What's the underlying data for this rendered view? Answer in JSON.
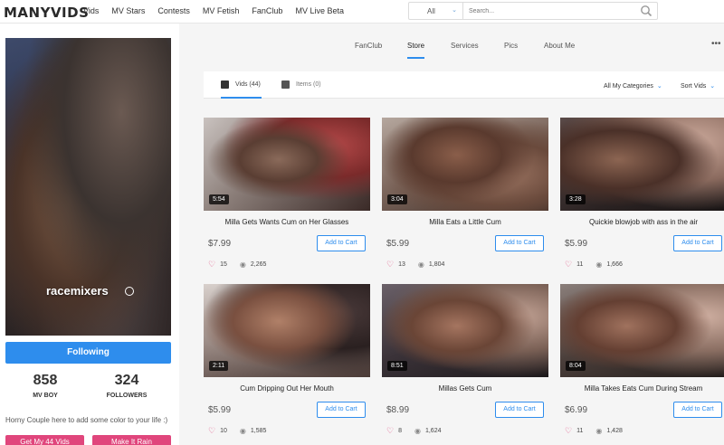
{
  "brand": "MANYVIDS",
  "nav": [
    "Vids",
    "MV Stars",
    "Contests",
    "MV Fetish",
    "FanClub",
    "MV Live Beta"
  ],
  "search": {
    "filter": "All",
    "placeholder": "Search..."
  },
  "profile": {
    "name": "racemixers",
    "follow_label": "Following",
    "stats": [
      {
        "value": "858",
        "label": "MV BOY"
      },
      {
        "value": "324",
        "label": "FOLLOWERS"
      }
    ],
    "bio": "Horny Couple here to add some color to your life :)",
    "buttons": [
      "Get My 44 Vids",
      "Make It Rain"
    ]
  },
  "profile_tabs": [
    "FanClub",
    "Store",
    "Services",
    "Pics",
    "About Me"
  ],
  "active_profile_tab": "Store",
  "store_tabs": [
    {
      "label": "Vids (44)",
      "icon": "clapperboard-icon"
    },
    {
      "label": "Items (0)",
      "icon": "tshirt-icon"
    }
  ],
  "filters": {
    "category": "All My Categories",
    "sort": "Sort Vids"
  },
  "cart_label": "Add to Cart",
  "videos": [
    {
      "title": "Milla Gets Wants Cum on Her Glasses",
      "duration": "5:54",
      "price": "$7.99",
      "likes": "15",
      "views": "2,265"
    },
    {
      "title": "Milla Eats a Little Cum",
      "duration": "3:04",
      "price": "$5.99",
      "likes": "13",
      "views": "1,804"
    },
    {
      "title": "Quickie blowjob with ass in the air",
      "duration": "3:28",
      "price": "$5.99",
      "likes": "11",
      "views": "1,666"
    },
    {
      "title": "Cum Dripping Out Her Mouth",
      "duration": "2:11",
      "price": "$5.99",
      "likes": "10",
      "views": "1,585"
    },
    {
      "title": "Millas Gets Cum",
      "duration": "8:51",
      "price": "$8.99",
      "likes": "8",
      "views": "1,624"
    },
    {
      "title": "Milla Takes Eats Cum During Stream",
      "duration": "8:04",
      "price": "$6.99",
      "likes": "11",
      "views": "1,428"
    }
  ],
  "colors": {
    "accent": "#2e8ded",
    "pink": "#e0467c"
  }
}
